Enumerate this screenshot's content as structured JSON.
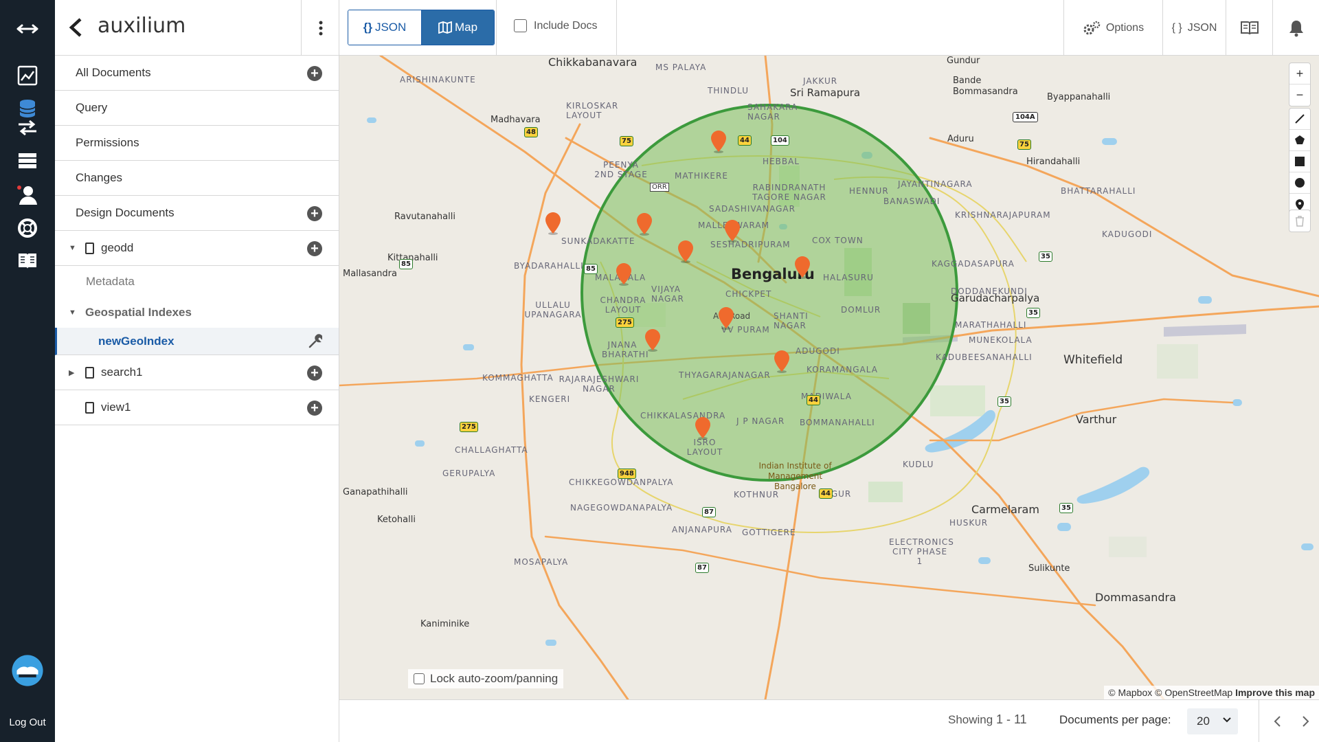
{
  "sidebar": {
    "db_name": "auxilium",
    "items": [
      {
        "label": "All Documents"
      },
      {
        "label": "Query"
      },
      {
        "label": "Permissions"
      },
      {
        "label": "Changes"
      },
      {
        "label": "Design Documents"
      }
    ],
    "design_docs": [
      {
        "name": "geodd"
      },
      {
        "name": "search1"
      },
      {
        "name": "view1"
      }
    ],
    "metadata_label": "Metadata",
    "geo_indexes_label": "Geospatial Indexes",
    "geo_index_name": "newGeoIndex"
  },
  "rail": {
    "logout_label": "Log Out"
  },
  "topbar": {
    "json_toggle": "JSON",
    "map_toggle": "Map",
    "include_docs_label": "Include Docs",
    "options_label": "Options",
    "json_label": "JSON"
  },
  "map": {
    "place_labels": [
      "Chikkabanavara",
      "Sri Ramapura",
      "Madhavara",
      "Ravutanahalli",
      "Kittanahalli",
      "Mallasandra",
      "Bengaluru",
      "Garudacharpalya",
      "Whitefield",
      "Varthur",
      "Carmelaram",
      "Dommasandra",
      "Ganapathihalli",
      "Ketohalli",
      "Kaniminike",
      "Sulikunte",
      "Bande Bommasandra",
      "Byappanahalli",
      "Aduru",
      "Hirandahalli",
      "Gundur"
    ],
    "area_labels": [
      "ARISHINAKUNTE",
      "MS PALAYA",
      "KIRLOSKAR LAYOUT",
      "THINDLU",
      "SAHAKARA NAGAR",
      "JAKKUR",
      "MATHIKERE",
      "HEBBAL",
      "RABINDRANATH TAGORE NAGAR",
      "HENNUR",
      "JAYANTINAGARA",
      "BHATTARAHALLI",
      "PEENYA 2ND STAGE",
      "SADASHIVANAGAR",
      "BANASWADI",
      "KRISHNARAJAPURAM",
      "MALLESWARAM",
      "SESHADRIPURAM",
      "COX TOWN",
      "SUNKADAKATTE",
      "BYADARAHALLI",
      "MALAGALA",
      "VIJAYA NAGAR",
      "CHICKPET",
      "HALASURU",
      "KAGGADASAPURA",
      "KADUGODI",
      "CHANDRA LAYOUT",
      "ULLALU UPANAGARA",
      "DODDANEKUNDI",
      "DOMLUR",
      "VV PURAM",
      "SHANTI NAGAR",
      "MARATHAHALLI",
      "JNANA BHARATHI",
      "ADUGODI",
      "MUNEKOLALA",
      "KADUBEESANAHALLI",
      "KOMMAGHATTA",
      "RAJARAJESHWARI NAGAR",
      "THYAGARAJANAGAR",
      "KORAMANGALA",
      "KENGERI",
      "MADIWALA",
      "CHIKKALASANDRA",
      "J P NAGAR",
      "BOMMANAHALLI",
      "CHALLAGHATTA",
      "ISRO LAYOUT",
      "GERUPALYA",
      "KUDLU",
      "CHIKKEGOWDANPALYA",
      "KOTHNUR",
      "BEGUR",
      "NAGEGOWDANAPALYA",
      "HUSKUR",
      "ANJANAPURA",
      "GOTTIGERE",
      "ELECTRONICS CITY PHASE 1",
      "MOSAPALYA"
    ],
    "road_labels": [
      "A V Road",
      "ORR"
    ],
    "highway_shields": [
      "48",
      "75",
      "44",
      "104",
      "85",
      "85",
      "275",
      "275",
      "44",
      "44",
      "948",
      "87",
      "87",
      "35",
      "35",
      "35",
      "35",
      "75",
      "104A"
    ],
    "poi_label": "Indian Institute of Management Bangalore",
    "lock_zoom_label": "Lock auto-zoom/panning",
    "attribution_mapbox": "© Mapbox",
    "attribution_osm": "© OpenStreetMap",
    "attribution_improve": "Improve this map",
    "marker_count": 11,
    "circle_color": "#2e8b2e",
    "marker_color": "#ef6a2d"
  },
  "footer": {
    "showing_prefix": "Showing",
    "showing_range": "1 - 11",
    "per_page_label": "Documents per page:",
    "per_page_value": "20"
  },
  "colors": {
    "rail_bg": "#17212b",
    "accent": "#1a5ba6",
    "map_bg": "#eeebe4"
  }
}
